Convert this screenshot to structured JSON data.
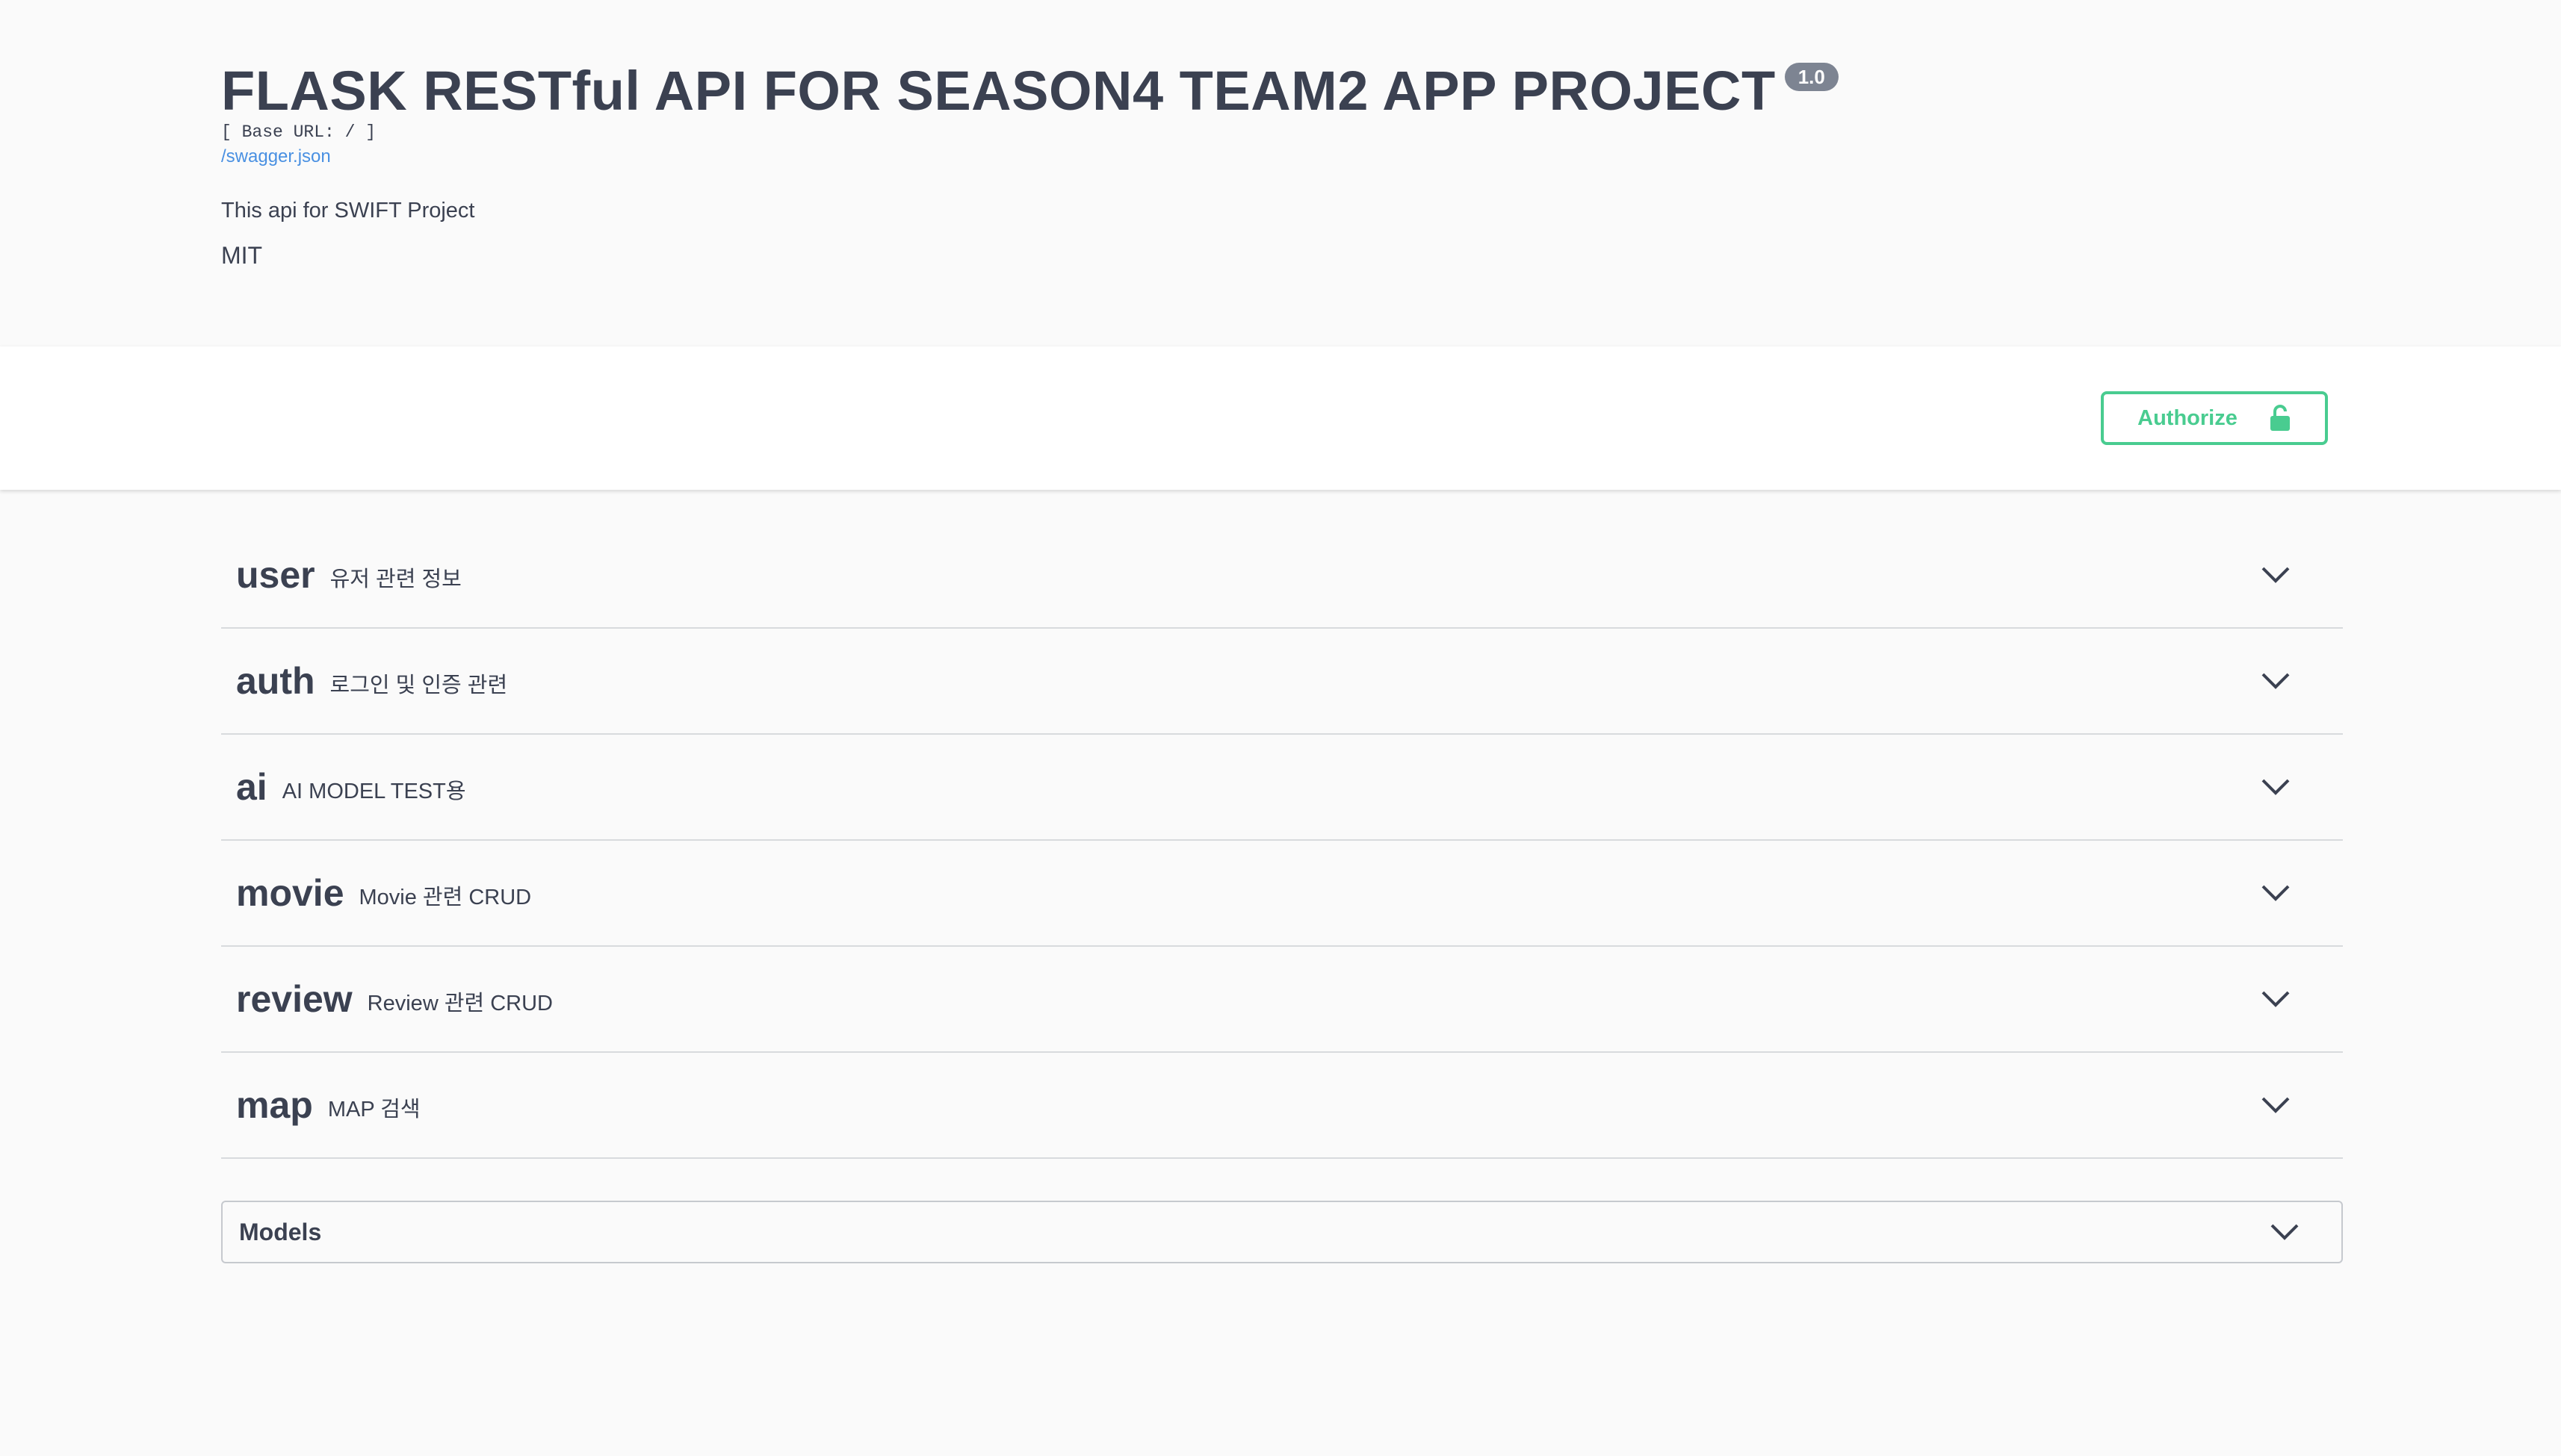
{
  "info": {
    "title": "FLASK RESTful API FOR SEASON4 TEAM2 APP PROJECT",
    "version": "1.0",
    "base_url": "[ Base URL: / ]",
    "spec_link": "/swagger.json",
    "description": "This api for SWIFT Project",
    "license": "MIT"
  },
  "scheme_bar": {
    "authorize_label": "Authorize",
    "authorize_icon": "unlock-icon",
    "accent_color": "#49cc90"
  },
  "tags": [
    {
      "name": "user",
      "description": "유저 관련 정보"
    },
    {
      "name": "auth",
      "description": "로그인 및 인증 관련"
    },
    {
      "name": "ai",
      "description": "AI MODEL TEST용"
    },
    {
      "name": "movie",
      "description": "Movie 관련 CRUD"
    },
    {
      "name": "review",
      "description": "Review 관련 CRUD"
    },
    {
      "name": "map",
      "description": "MAP 검색"
    }
  ],
  "models": {
    "title": "Models"
  }
}
